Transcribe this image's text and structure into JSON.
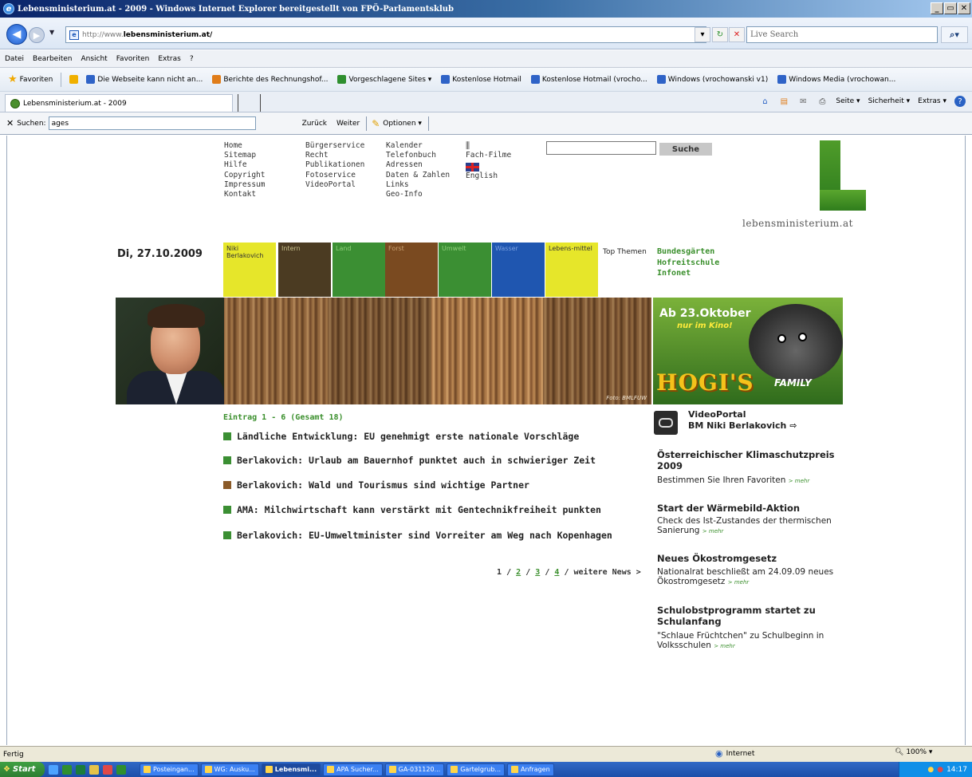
{
  "window": {
    "title": "Lebensministerium.at - 2009 - Windows Internet Explorer bereitgestellt von FPÖ-Parlamentsklub",
    "controls": [
      "_",
      "▭",
      "✕"
    ]
  },
  "address": {
    "protocol": "http://www.",
    "domain": "lebensministerium.at/",
    "live_search_placeholder": "Live Search"
  },
  "menu": [
    "Datei",
    "Bearbeiten",
    "Ansicht",
    "Favoriten",
    "Extras",
    "?"
  ],
  "favorites": {
    "label": "Favoriten",
    "items": [
      {
        "label": "Die Webseite kann nicht an...",
        "color": "#2f63c7"
      },
      {
        "label": "Berichte des Rechnungshof...",
        "color": "#e07d1a"
      },
      {
        "label": "Vorgeschlagene Sites ▾",
        "color": "#2f8f2f"
      },
      {
        "label": "Kostenlose Hotmail",
        "color": "#2f63c7"
      },
      {
        "label": "Kostenlose Hotmail (vrocho...",
        "color": "#2f63c7"
      },
      {
        "label": "Windows (vrochowanski v1)",
        "color": "#2f63c7"
      },
      {
        "label": "Windows Media (vrochowan...",
        "color": "#2f63c7"
      }
    ]
  },
  "tab": {
    "label": "Lebensministerium.at - 2009"
  },
  "command_bar": [
    "Seite ▾",
    "Sicherheit ▾",
    "Extras ▾"
  ],
  "search_toolbar": {
    "close": "✕",
    "label": "Suchen:",
    "value": "ages",
    "back": "Zurück",
    "forward": "Weiter",
    "options": "Optionen ▾"
  },
  "site": {
    "nav_col1": [
      "Home",
      "Sitemap",
      "Hilfe",
      "Copyright",
      "Impressum",
      "Kontakt"
    ],
    "nav_col2": [
      "Bürgerservice",
      "Recht",
      "Publikationen",
      "Fotoservice",
      "VideoPortal"
    ],
    "nav_col3": [
      "Kalender",
      "Telefonbuch",
      "Adressen",
      "Daten & Zahlen",
      "Links",
      "Geo-Info"
    ],
    "nav_col4": [
      "Fach-Filme",
      "English"
    ],
    "search_button": "Suche",
    "logo_text": "lebensministerium.at",
    "date": "Di, 27.10.2009",
    "categories": [
      {
        "label": "Niki Berlakovich",
        "bg": "#e6e62a",
        "fg": "#333"
      },
      {
        "label": "Intern",
        "bg": "#4b3b22",
        "fg": "#c8c08a"
      },
      {
        "label": "Land",
        "bg": "#3b8f33",
        "fg": "#8fd07a"
      },
      {
        "label": "Forst",
        "bg": "#7a4a20",
        "fg": "#c8a070"
      },
      {
        "label": "Umwelt",
        "bg": "#3b8f33",
        "fg": "#8fd07a"
      },
      {
        "label": "Wasser",
        "bg": "#1f56b0",
        "fg": "#7aa0e0"
      },
      {
        "label": "Lebens-mittel",
        "bg": "#e6e62a",
        "fg": "#333"
      }
    ],
    "top_themen_label": "Top Themen",
    "top_themen": [
      "Bundesgärten",
      "Hofreitschule",
      "Infonet"
    ],
    "foto_credit": "Foto: BMLFUW",
    "ad": {
      "line1": "Ab 23.Oktober",
      "line2": "nur im Kino!",
      "line3": "HOGI'S",
      "line4": "FAMILY"
    },
    "eintrag": "Eintrag 1 - 6 (Gesamt 18)",
    "news": [
      {
        "title": "Ländliche Entwicklung: EU genehmigt erste nationale Vorschläge",
        "color": "#3b8f33"
      },
      {
        "title": "Berlakovich: Urlaub am Bauernhof punktet auch in schwieriger Zeit",
        "color": "#3b8f33"
      },
      {
        "title": "Berlakovich: Wald und Tourismus sind wichtige Partner",
        "color": "#8a5a28"
      },
      {
        "title": "AMA: Milchwirtschaft kann verstärkt mit Gentechnikfreiheit punkten",
        "color": "#3b8f33"
      },
      {
        "title": "Berlakovich: EU-Umweltminister sind Vorreiter am Weg nach Kopenhagen",
        "color": "#3b8f33"
      }
    ],
    "pager": {
      "current": "1",
      "pages": [
        "2",
        "3",
        "4"
      ],
      "sep": "/",
      "more": "weitere News >"
    },
    "videoportal": {
      "line1": "VideoPortal",
      "line2": "BM Niki Berlakovich ⇨"
    },
    "right_items": [
      {
        "head": "Österreichischer Klimaschutzpreis 2009",
        "body": "Bestimmen Sie Ihren Favoriten",
        "mehr": "> mehr"
      },
      {
        "head": "Start der Wärmebild-Aktion",
        "body": "Check des Ist-Zustandes der thermischen Sanierung",
        "mehr": "> mehr"
      },
      {
        "head": "Neues Ökostromgesetz",
        "body": "Nationalrat beschließt am 24.09.09 neues Ökostromgesetz",
        "mehr": "> mehr"
      },
      {
        "head": "Schulobstprogramm startet zu Schulanfang",
        "body": "\"Schlaue Früchtchen\" zu Schulbeginn in Volksschulen",
        "mehr": "> mehr"
      }
    ]
  },
  "status": {
    "text": "Fertig",
    "zone": "Internet",
    "zoom": "100%"
  },
  "taskbar": {
    "start": "Start",
    "buttons": [
      {
        "label": "Posteingan...",
        "active": false
      },
      {
        "label": "WG: Ausku...",
        "active": false
      },
      {
        "label": "Lebensmi...",
        "active": true
      },
      {
        "label": "APA Sucher...",
        "active": false
      },
      {
        "label": "GA-031120...",
        "active": false
      },
      {
        "label": "Gartelgrub...",
        "active": false
      },
      {
        "label": "Anfragen",
        "active": false
      }
    ],
    "clock": "14:17"
  }
}
